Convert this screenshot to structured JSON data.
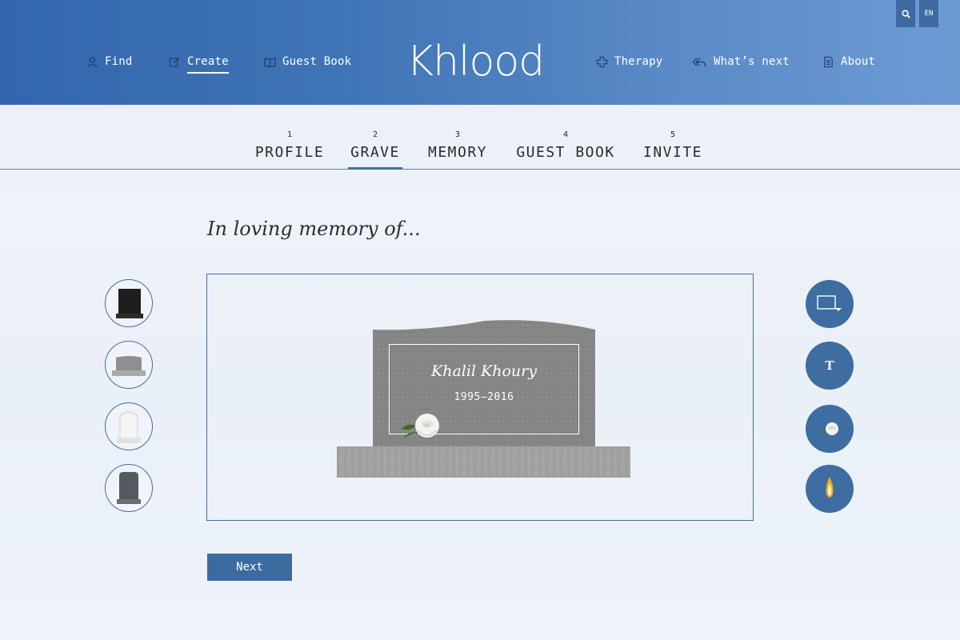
{
  "nav": {
    "left": [
      {
        "label": "Find",
        "icon": "user-icon"
      },
      {
        "label": "Create",
        "icon": "edit-icon"
      },
      {
        "label": "Guest Book",
        "icon": "book-icon"
      }
    ],
    "right": [
      {
        "label": "Therapy",
        "icon": "plus-icon"
      },
      {
        "label": "What’s next",
        "icon": "reply-all-icon"
      },
      {
        "label": "About",
        "icon": "document-icon"
      }
    ],
    "logo": "Khlood",
    "language": "EN"
  },
  "steps": [
    {
      "num": "1",
      "name": "PROFILE"
    },
    {
      "num": "2",
      "name": "GRAVE"
    },
    {
      "num": "3",
      "name": "MEMORY"
    },
    {
      "num": "4",
      "name": "GUEST BOOK"
    },
    {
      "num": "5",
      "name": "INVITE"
    }
  ],
  "active_step": "GRAVE",
  "heading": "In loving memory of...",
  "grave": {
    "name": "Khalil Khoury",
    "dates": "1995–2016"
  },
  "tools": {
    "text_label": "T"
  },
  "next_label": "Next",
  "colors": {
    "header_blue": "#3f74b6",
    "accent": "#3d6da1",
    "border": "#3f6ea4"
  }
}
